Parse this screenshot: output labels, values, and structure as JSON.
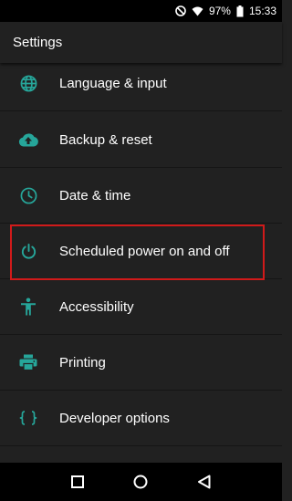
{
  "status_bar": {
    "battery": "97%",
    "time": "15:33",
    "icons": [
      "do-not-disturb-icon",
      "wifi-icon",
      "battery-icon"
    ]
  },
  "app_bar": {
    "title": "Settings"
  },
  "settings_items": [
    {
      "label": "Language & input",
      "icon": "globe-icon"
    },
    {
      "label": "Backup & reset",
      "icon": "cloud-upload-icon"
    },
    {
      "label": "Date & time",
      "icon": "clock-icon"
    },
    {
      "label": "Scheduled power on and off",
      "icon": "power-icon"
    },
    {
      "label": "Accessibility",
      "icon": "accessibility-icon"
    },
    {
      "label": "Printing",
      "icon": "printer-icon"
    },
    {
      "label": "Developer options",
      "icon": "braces-icon"
    }
  ],
  "colors": {
    "accent": "#26a69a",
    "background": "#212121",
    "highlight": "#d11a1a"
  },
  "nav_bar": {
    "buttons": [
      "recents-icon",
      "home-icon",
      "back-icon"
    ]
  }
}
